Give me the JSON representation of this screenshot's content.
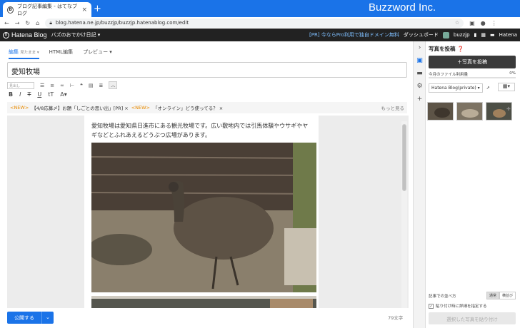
{
  "browser": {
    "tab_title": "ブログ記事編集 - はてなブログ",
    "tab_close": "×",
    "new_tab": "+",
    "url": "blog.hatena.ne.jp/buzzjp/buzzjp.hatenablog.com/edit",
    "brand_overlay": "Buzzword Inc."
  },
  "hatena_bar": {
    "logo": "Hatena Blog",
    "blog_name": "バズのおでかけ日記 ▾",
    "promo": "[PR] 今ならPro利用で独自ドメイン無料",
    "dashboard": "ダッシュボード",
    "user": "buzzjp",
    "right_logo": "Hatena"
  },
  "editor": {
    "modes": [
      {
        "label": "編集",
        "sub": "見たまま ▾",
        "active": true
      },
      {
        "label": "HTML編集",
        "sub": "",
        "active": false
      },
      {
        "label": "プレビュー ▾",
        "sub": "",
        "active": false
      }
    ],
    "title": "愛知牧場",
    "heading_select": "見出し",
    "news": [
      {
        "tag": "<NEW>",
        "text": "【4/8応募〆】お題「しごとの思い出」[PR] ×"
      },
      {
        "tag": "<NEW>",
        "text": "「オンライン」どう使ってる？ ×"
      }
    ],
    "news_more": "もっと見る",
    "body_text": "愛知牧場は愛知県日進市にある観光牧場です。広い敷地内では引馬体験やウサギやヤギなどとふれあえるどうぶつ広場があります。",
    "publish": "公開する",
    "char_count": "79文字"
  },
  "panel": {
    "title": "写真を投稿",
    "post_button": "＋写真を投稿",
    "usage_label": "今月のファイル利用量",
    "usage_value": "0%",
    "usage_percent": 0,
    "source": "Hatena Blog(private) ▾",
    "layout_label": "記事での並べ方",
    "layout_options": [
      "通常",
      "横並び"
    ],
    "detail_label": "貼り付け時に詳細を指定する",
    "paste_button": "選択した写真を貼り付け"
  }
}
